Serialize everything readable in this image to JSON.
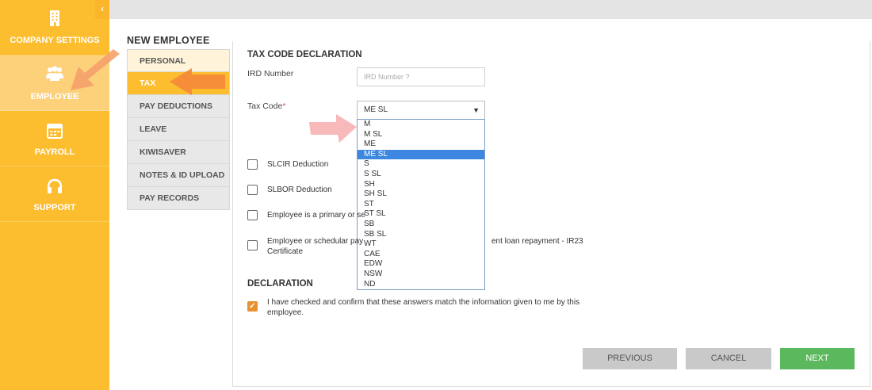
{
  "app_sidebar": {
    "items": [
      {
        "label": "COMPANY SETTINGS",
        "icon": "building-icon"
      },
      {
        "label": "EMPLOYEE",
        "icon": "people-icon"
      },
      {
        "label": "PAYROLL",
        "icon": "payroll-calendar-icon"
      },
      {
        "label": "SUPPORT",
        "icon": "headset-icon"
      }
    ],
    "collapse_glyph": "‹"
  },
  "page": {
    "title": "NEW EMPLOYEE"
  },
  "sub_menu": {
    "items": [
      {
        "label": "PERSONAL"
      },
      {
        "label": "TAX"
      },
      {
        "label": "PAY DEDUCTIONS"
      },
      {
        "label": "LEAVE"
      },
      {
        "label": "KIWISAVER"
      },
      {
        "label": "NOTES & ID UPLOAD"
      },
      {
        "label": "PAY RECORDS"
      }
    ],
    "active": "TAX"
  },
  "tax_form": {
    "section_title": "TAX CODE DECLARATION",
    "ird_label": "IRD Number",
    "ird_placeholder": "IRD Number ?",
    "tax_code_label": "Tax Code",
    "tax_code_required": "*",
    "tax_code_value": "ME SL",
    "tax_code_options": [
      "M",
      "M SL",
      "ME",
      "ME SL",
      "S",
      "S SL",
      "SH",
      "SH SL",
      "ST",
      "ST SL",
      "SB",
      "SB SL",
      "WT",
      "CAE",
      "EDW",
      "NSW",
      "ND"
    ],
    "checkboxes": [
      {
        "label": "SLCIR Deduction",
        "checked": false
      },
      {
        "label": "SLBOR Deduction",
        "checked": false
      },
      {
        "label": "Employee is a primary or se",
        "checked": false
      },
      {
        "label_line1": "Employee or schedular pay",
        "label_line1_tail": "ent loan repayment - IR23",
        "label_line2": "Certificate",
        "checked": false
      }
    ]
  },
  "declaration": {
    "section_title": "DECLARATION",
    "text_line1": "I have checked and confirm that these answers match the information given to me by this",
    "text_line2": "employee.",
    "checked": true,
    "check_glyph": "✓"
  },
  "buttons": {
    "previous": "PREVIOUS",
    "cancel": "CANCEL",
    "next": "NEXT"
  },
  "colors": {
    "brand_yellow": "#fcbd2f",
    "next_green": "#5cb85c",
    "selected_blue": "#3d87e0",
    "annotation_orange": "#f5a06a",
    "annotation_pink": "#f7b5b5"
  }
}
